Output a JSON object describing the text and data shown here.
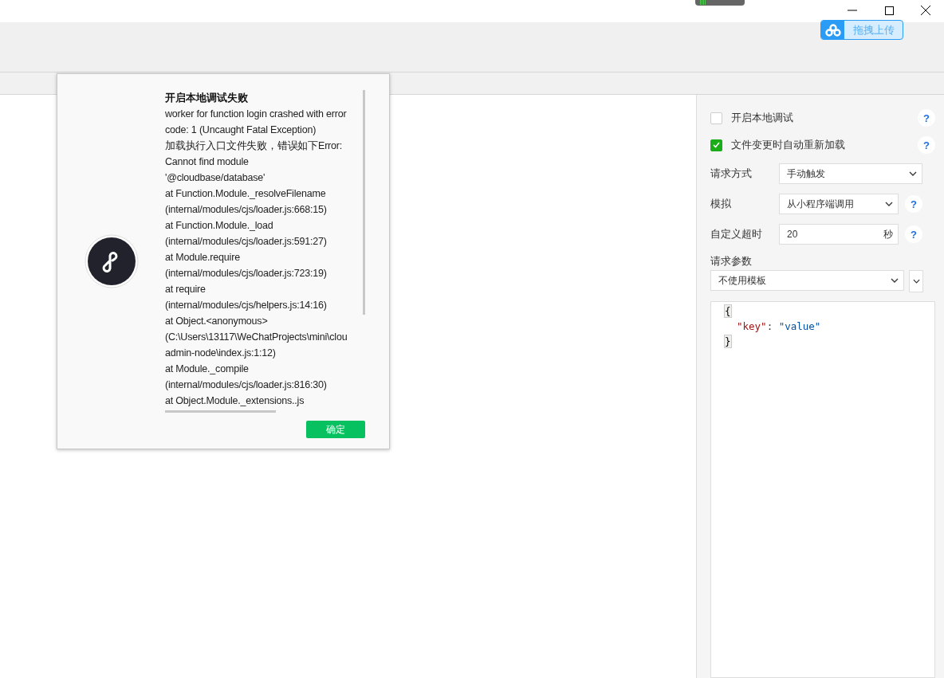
{
  "toolbar": {
    "upload_button": "拖拽上传"
  },
  "dialog": {
    "title": "开启本地调试失败",
    "lines": [
      "worker for function login crashed with error",
      "code: 1 (Uncaught Fatal Exception)",
      "加载执行入口文件失败，错误如下Error:",
      "Cannot find module",
      "'@cloudbase/database'",
      "at Function.Module._resolveFilename",
      "(internal/modules/cjs/loader.js:668:15)",
      "at Function.Module._load",
      "(internal/modules/cjs/loader.js:591:27)",
      "at Module.require",
      "(internal/modules/cjs/loader.js:723:19)",
      "at require",
      "(internal/modules/cjs/helpers.js:14:16)",
      "at Object.<anonymous>",
      "(C:\\Users\\13117\\WeChatProjects\\mini\\clou",
      "admin-node\\index.js:1:12)",
      "at Module._compile",
      "(internal/modules/cjs/loader.js:816:30)",
      "at Object.Module._extensions..js"
    ],
    "confirm": "确定"
  },
  "panel": {
    "options": [
      {
        "label": "开启本地调试",
        "checked": false,
        "help": "?"
      },
      {
        "label": "文件变更时自动重新加载",
        "checked": true,
        "help": "?"
      }
    ],
    "fields": [
      {
        "kind": "select",
        "label": "请求方式",
        "value": "手动触发"
      },
      {
        "kind": "select",
        "label": "模拟",
        "value": "从小程序端调用",
        "help": "?"
      },
      {
        "kind": "number",
        "label": "自定义超时",
        "value": "20",
        "unit": "秒",
        "help": "?"
      }
    ],
    "params": {
      "label": "请求参数",
      "template": "不使用模板",
      "code": [
        {
          "kind": "brace",
          "text": "{"
        },
        {
          "kind": "pair",
          "key": "\"key\"",
          "sep": ": ",
          "value": "\"value\""
        },
        {
          "kind": "brace",
          "text": "}"
        }
      ]
    }
  }
}
